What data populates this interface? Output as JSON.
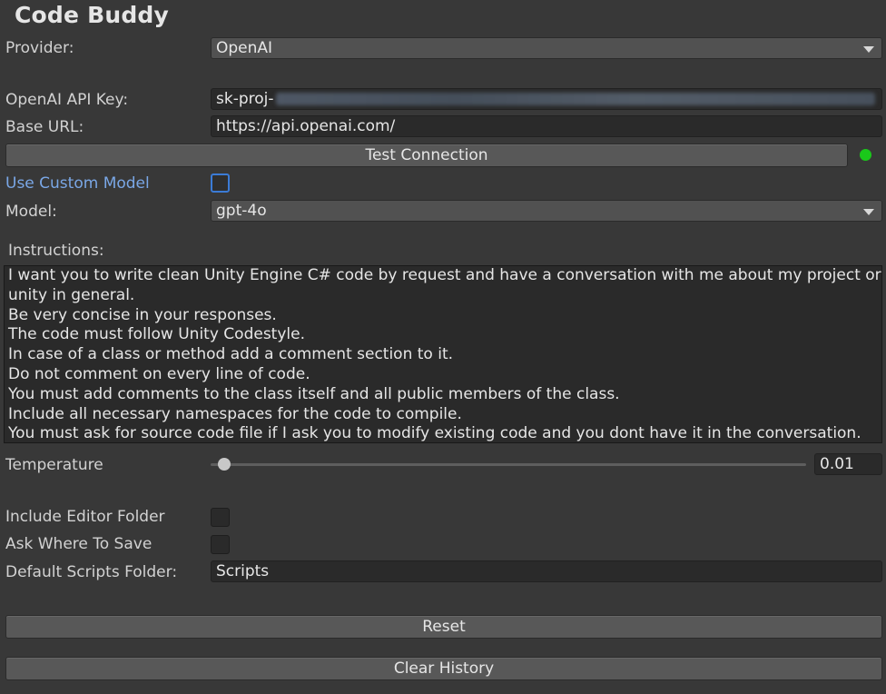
{
  "title": "Code Buddy",
  "provider": {
    "label": "Provider:",
    "value": "OpenAI"
  },
  "api_key": {
    "label": "OpenAI API Key:",
    "value_prefix": "sk-proj-"
  },
  "base_url": {
    "label": "Base URL:",
    "value": "https://api.openai.com/"
  },
  "test_connection": {
    "label": "Test Connection",
    "status_color": "#1ac81a"
  },
  "custom_model": {
    "label": "Use Custom Model",
    "checked": false
  },
  "model": {
    "label": "Model:",
    "value": "gpt-4o"
  },
  "instructions": {
    "label": "Instructions:",
    "lines": [
      "I want you to write clean Unity Engine C# code by request and have a conversation with me about my project or",
      "unity in general.",
      "Be very concise in your responses.",
      "The code must follow Unity Codestyle.",
      "In case of a class or method add a comment section to it.",
      "Do not comment on every line of code.",
      "You must add comments to the class itself and all public members of the class.",
      "Include all necessary namespaces for the code to compile.",
      "You must ask for source code file if I ask you to modify existing code and you dont have it in the conversation."
    ]
  },
  "temperature": {
    "label": "Temperature",
    "value": "0.01"
  },
  "include_editor_folder": {
    "label": "Include Editor Folder",
    "checked": false
  },
  "ask_where_to_save": {
    "label": "Ask Where To Save",
    "checked": false
  },
  "default_scripts_folder": {
    "label": "Default Scripts Folder:",
    "value": "Scripts"
  },
  "reset_button": "Reset",
  "clear_history_button": "Clear History",
  "colors": {
    "background": "#383838",
    "link_label": "#7aa7e6",
    "focus_outline": "#3b7bd6"
  }
}
